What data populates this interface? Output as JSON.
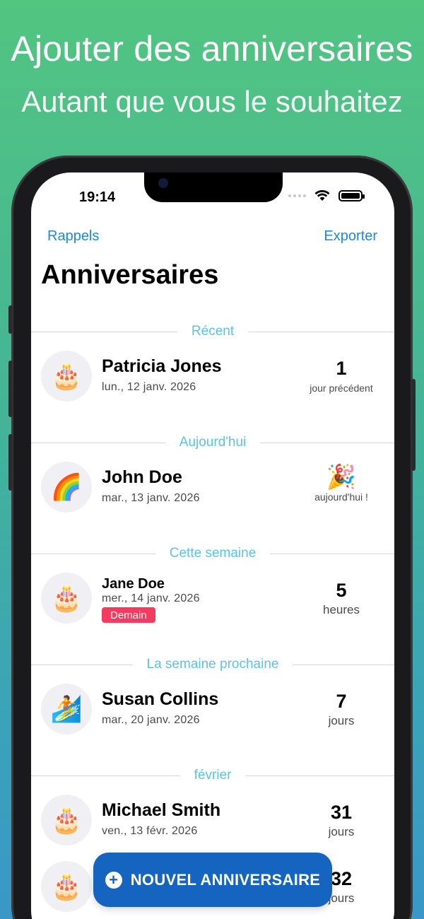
{
  "promo": {
    "headline": "Ajouter des anniversaires",
    "subline": "Autant que vous le souhaitez"
  },
  "status_bar": {
    "time": "19:14"
  },
  "nav": {
    "left": "Rappels",
    "right": "Exporter"
  },
  "page_title": "Anniversaires",
  "sections": [
    {
      "header": "Récent",
      "items": [
        {
          "avatar": "🎂",
          "name": "Patricia Jones",
          "date": "lun., 12 janv. 2026",
          "count": "1",
          "unit": "jour précédent"
        }
      ]
    },
    {
      "header": "Aujourd'hui",
      "items": [
        {
          "avatar": "🌈",
          "name": "John Doe",
          "date": "mar., 13 janv. 2026",
          "emoji": "🎉",
          "unit": "aujourd'hui !"
        }
      ]
    },
    {
      "header": "Cette semaine",
      "items": [
        {
          "avatar": "🎂",
          "name": "Jane Doe",
          "date": "mer., 14 janv. 2026",
          "badge": "Demain",
          "count": "5",
          "unit": "heures"
        }
      ]
    },
    {
      "header": "La semaine prochaine",
      "items": [
        {
          "avatar": "🏄",
          "name": "Susan Collins",
          "date": "mar., 20 janv. 2026",
          "count": "7",
          "unit": "jours"
        }
      ]
    },
    {
      "header": "février",
      "items": [
        {
          "avatar": "🎂",
          "name": "Michael Smith",
          "date": "ven., 13 févr. 2026",
          "count": "31",
          "unit": "jours"
        },
        {
          "avatar": "🎂",
          "count": "32",
          "unit": "jours"
        }
      ]
    }
  ],
  "fab": {
    "label": "NOUVEL ANNIVERSAIRE"
  }
}
